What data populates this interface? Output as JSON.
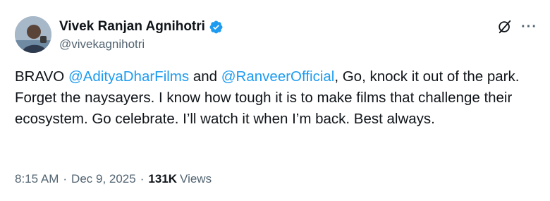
{
  "author": {
    "display_name": "Vivek Ranjan Agnihotri",
    "handle": "@vivekagnihotri",
    "verified_badge_color": "#1d9bf0"
  },
  "tweet": {
    "parts": [
      {
        "text": "BRAVO ",
        "mention": false
      },
      {
        "text": "@AdityaDharFilms",
        "mention": true
      },
      {
        "text": " and ",
        "mention": false
      },
      {
        "text": "@RanveerOfficial",
        "mention": true
      },
      {
        "text": ", Go, knock it out of the park. Forget the naysayers. I know how tough it is to make films that challenge their ecosystem. Go celebrate. I’ll watch it when I’m back. Best always.",
        "mention": false
      }
    ],
    "mention_color": "#1d9bf0"
  },
  "meta": {
    "time": "8:15 AM",
    "separator": "·",
    "date": "Dec 9, 2025",
    "views_count": "131K",
    "views_label": "Views"
  },
  "icons": {
    "grok": "grok-icon",
    "more": "more-icon",
    "verified": "verified-badge-icon"
  }
}
